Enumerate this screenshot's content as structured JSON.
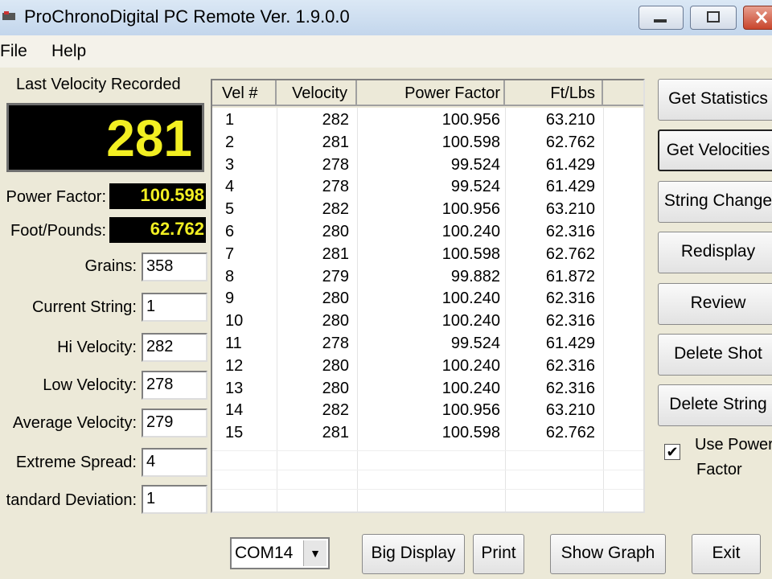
{
  "window": {
    "title": "ProChronoDigital PC Remote Ver. 1.9.0.0"
  },
  "menu": [
    {
      "label": "File"
    },
    {
      "label": "Help"
    }
  ],
  "last_velocity": {
    "label": "Last Velocity Recorded",
    "value": "281"
  },
  "readouts": {
    "power_factor": {
      "label": "Power Factor:",
      "value": "100.598"
    },
    "foot_pounds": {
      "label": "Foot/Pounds:",
      "value": "62.762"
    }
  },
  "fields": [
    {
      "label": "Grains:",
      "value": "358"
    },
    {
      "label": "Current String:",
      "value": "1"
    },
    {
      "label": "Hi Velocity:",
      "value": "282"
    },
    {
      "label": "Low Velocity:",
      "value": "278"
    },
    {
      "label": "Average Velocity:",
      "value": "279"
    },
    {
      "label": "Extreme Spread:",
      "value": "4"
    },
    {
      "label": "tandard Deviation:",
      "value": "1"
    }
  ],
  "table": {
    "columns": [
      "Vel #",
      "Velocity",
      "Power Factor",
      "Ft/Lbs"
    ],
    "rows": [
      [
        "1",
        "282",
        "100.956",
        "63.210"
      ],
      [
        "2",
        "281",
        "100.598",
        "62.762"
      ],
      [
        "3",
        "278",
        "99.524",
        "61.429"
      ],
      [
        "4",
        "278",
        "99.524",
        "61.429"
      ],
      [
        "5",
        "282",
        "100.956",
        "63.210"
      ],
      [
        "6",
        "280",
        "100.240",
        "62.316"
      ],
      [
        "7",
        "281",
        "100.598",
        "62.762"
      ],
      [
        "8",
        "279",
        "99.882",
        "61.872"
      ],
      [
        "9",
        "280",
        "100.240",
        "62.316"
      ],
      [
        "10",
        "280",
        "100.240",
        "62.316"
      ],
      [
        "11",
        "278",
        "99.524",
        "61.429"
      ],
      [
        "12",
        "280",
        "100.240",
        "62.316"
      ],
      [
        "13",
        "280",
        "100.240",
        "62.316"
      ],
      [
        "14",
        "282",
        "100.956",
        "63.210"
      ],
      [
        "15",
        "281",
        "100.598",
        "62.762"
      ]
    ]
  },
  "side_buttons": [
    {
      "label": "Get Statistics"
    },
    {
      "label": "Get Velocities"
    },
    {
      "label": "String Change"
    },
    {
      "label": "Redisplay"
    },
    {
      "label": "Review"
    },
    {
      "label": "Delete Shot"
    },
    {
      "label": "Delete String"
    }
  ],
  "use_power_factor": {
    "line1": "Use Power",
    "line2": "Factor",
    "checked": true
  },
  "bottom": {
    "com_port": "COM14",
    "big_display": "Big Display",
    "print": "Print",
    "show_graph": "Show Graph",
    "exit": "Exit"
  },
  "colors": {
    "led_text": "#f2ef22",
    "led_bg": "#000000",
    "face": "#ece9d8"
  },
  "icons": [
    "app-icon",
    "minimize-icon",
    "maximize-icon",
    "close-icon",
    "chevron-down-icon",
    "check-icon"
  ]
}
